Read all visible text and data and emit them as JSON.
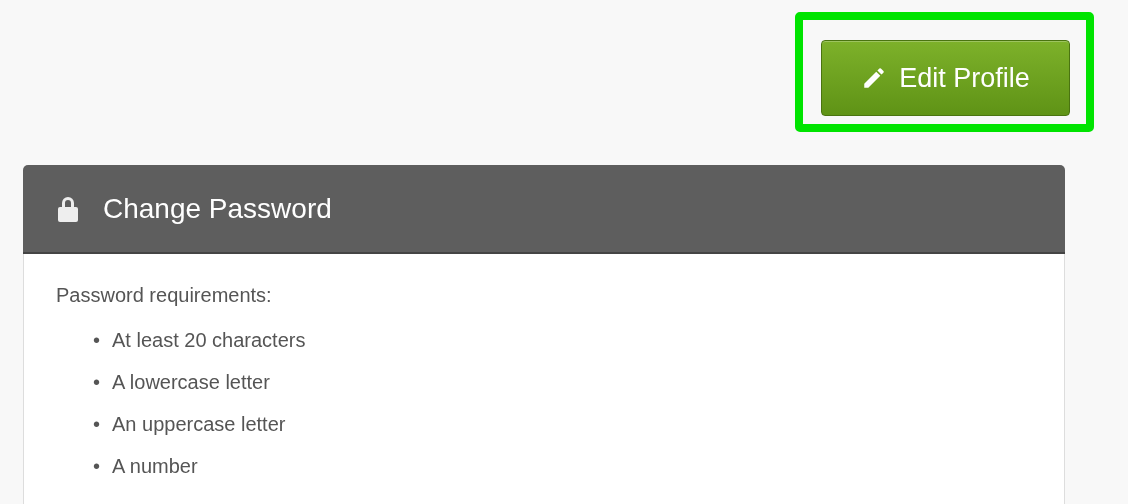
{
  "edit_button": {
    "label": "Edit Profile",
    "highlighted": true
  },
  "panel": {
    "title": "Change Password",
    "intro": "Password requirements:",
    "requirements": [
      {
        "bullet": "•",
        "text": "At least 20 characters"
      },
      {
        "bullet": "•",
        "text": "A lowercase letter"
      },
      {
        "bullet": "•",
        "text": "An uppercase letter"
      },
      {
        "bullet": "•",
        "text": "A number"
      }
    ]
  }
}
